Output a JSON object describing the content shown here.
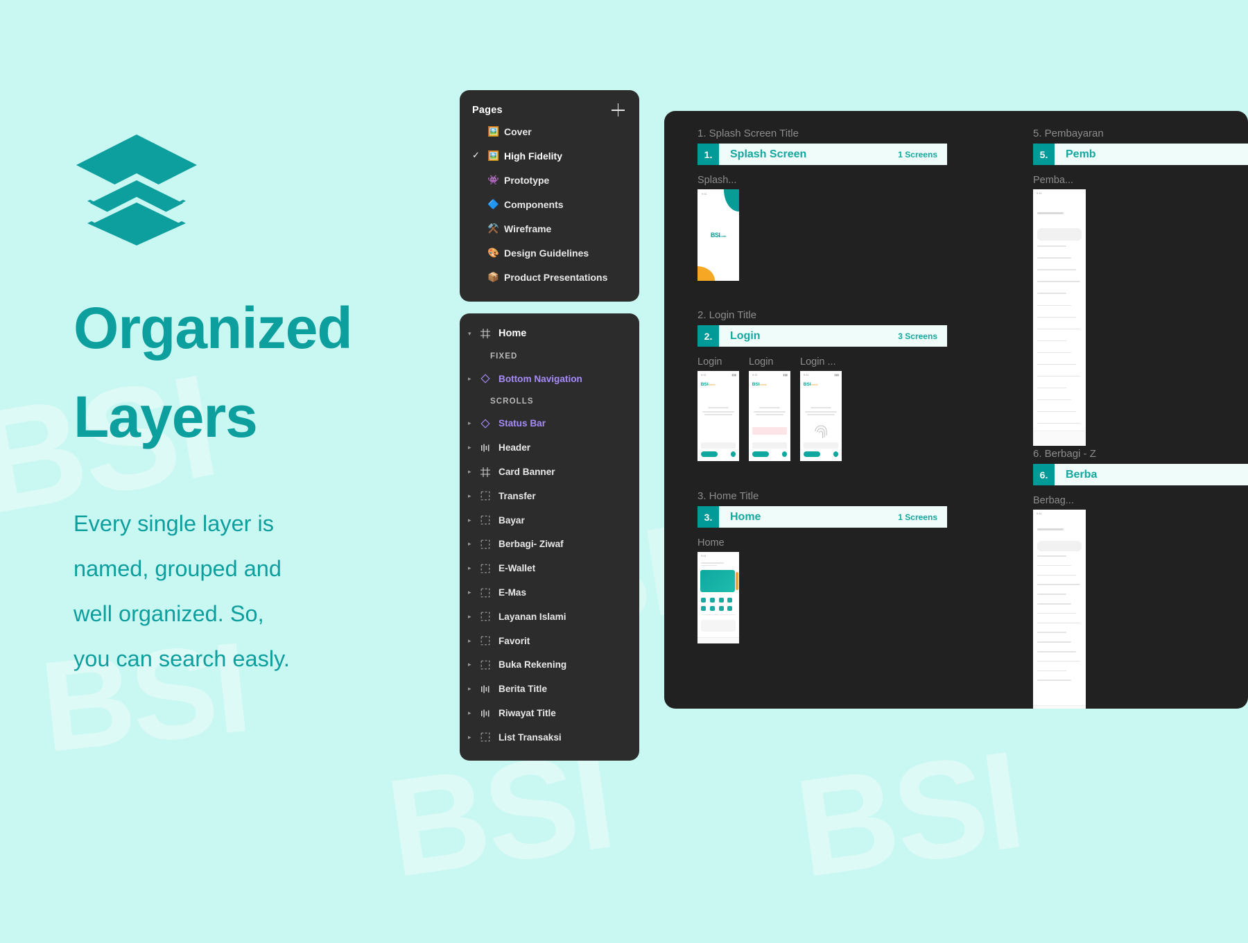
{
  "theme": {
    "bg": "#c9f7f2",
    "teal": "#0d9e9e",
    "panel_bg": "#2c2c2c",
    "board_bg": "#212121",
    "accent_title": "#12a8a0",
    "badge_bg": "#009a99",
    "purple": "#a78bfa"
  },
  "watermarks": [
    "BSI",
    "BSI",
    "BSI",
    "BSI",
    "BSI"
  ],
  "hero": {
    "logo_icon": "layers-stack-icon",
    "headline_line1": "Organized",
    "headline_line2": "Layers",
    "body_line1": "Every single layer is",
    "body_line2": "named, grouped and",
    "body_line3": "well organized. So,",
    "body_line4": "you can search easly."
  },
  "pages_panel": {
    "title": "Pages",
    "add_icon": "plus-icon",
    "items": [
      {
        "label": "Cover",
        "emoji": "🖼️",
        "icon": "image-icon",
        "checked": false
      },
      {
        "label": "High Fidelity",
        "emoji": "🖼️",
        "icon": "image-icon",
        "checked": true
      },
      {
        "label": "Prototype",
        "emoji": "👾",
        "icon": "alien-icon",
        "checked": false
      },
      {
        "label": "Components",
        "emoji": "🔷",
        "icon": "diamond-icon",
        "checked": false
      },
      {
        "label": "Wireframe",
        "emoji": "⚒️",
        "icon": "tools-icon",
        "checked": false
      },
      {
        "label": "Design Guidelines",
        "emoji": "🎨",
        "icon": "palette-icon",
        "checked": false
      },
      {
        "label": "Product Presentations",
        "emoji": "📦",
        "icon": "package-icon",
        "checked": false
      }
    ],
    "check_glyph": "✓"
  },
  "layers_panel": {
    "root": {
      "label": "Home",
      "icon": "frame-icon",
      "caret": "▾"
    },
    "sections": [
      {
        "label": "FIXED",
        "items": [
          {
            "label": "Bottom Navigation",
            "icon": "component-icon",
            "purple": true
          }
        ]
      },
      {
        "label": "SCROLLS",
        "items": [
          {
            "label": "Status Bar",
            "icon": "component-icon",
            "purple": true
          },
          {
            "label": "Header",
            "icon": "autolayout-icon",
            "purple": false
          },
          {
            "label": "Card Banner",
            "icon": "frame-icon",
            "purple": false
          },
          {
            "label": "Transfer",
            "icon": "group-icon",
            "purple": false
          },
          {
            "label": "Bayar",
            "icon": "group-icon",
            "purple": false
          },
          {
            "label": "Berbagi- Ziwaf",
            "icon": "group-icon",
            "purple": false
          },
          {
            "label": "E-Wallet",
            "icon": "group-icon",
            "purple": false
          },
          {
            "label": "E-Mas",
            "icon": "group-icon",
            "purple": false
          },
          {
            "label": "Layanan Islami",
            "icon": "group-icon",
            "purple": false
          },
          {
            "label": "Favorit",
            "icon": "group-icon",
            "purple": false
          },
          {
            "label": "Buka Rekening",
            "icon": "group-icon",
            "purple": false
          },
          {
            "label": "Berita Title",
            "icon": "autolayout-icon",
            "purple": false
          },
          {
            "label": "Riwayat Title",
            "icon": "autolayout-icon",
            "purple": false
          },
          {
            "label": "List Transaksi",
            "icon": "group-icon",
            "purple": false
          }
        ]
      }
    ],
    "caret_collapsed": "▸"
  },
  "board": {
    "sections": [
      {
        "caption": "1. Splash Screen Title",
        "number": "1.",
        "name": "Splash Screen",
        "count": "1 Screens",
        "thumbs": [
          {
            "caption": "Splash...",
            "kind": "splash"
          }
        ]
      },
      {
        "caption": "2. Login Title",
        "number": "2.",
        "name": "Login",
        "count": "3 Screens",
        "thumbs": [
          {
            "caption": "Login",
            "kind": "login1"
          },
          {
            "caption": "Login",
            "kind": "login2"
          },
          {
            "caption": "Login ...",
            "kind": "login3"
          }
        ]
      },
      {
        "caption": "3. Home Title",
        "number": "3.",
        "name": "Home",
        "count": "1 Screens",
        "thumbs": [
          {
            "caption": "Home",
            "kind": "home"
          }
        ]
      },
      {
        "caption": "5. Pembayaran",
        "number": "5.",
        "name": "Pemb",
        "count": "",
        "thumbs": [
          {
            "caption": "Pemba...",
            "kind": "list"
          }
        ]
      },
      {
        "caption": "6. Berbagi - Z",
        "number": "6.",
        "name": "Berba",
        "count": "",
        "thumbs": [
          {
            "caption": "Berbag...",
            "kind": "list2"
          }
        ]
      }
    ]
  }
}
